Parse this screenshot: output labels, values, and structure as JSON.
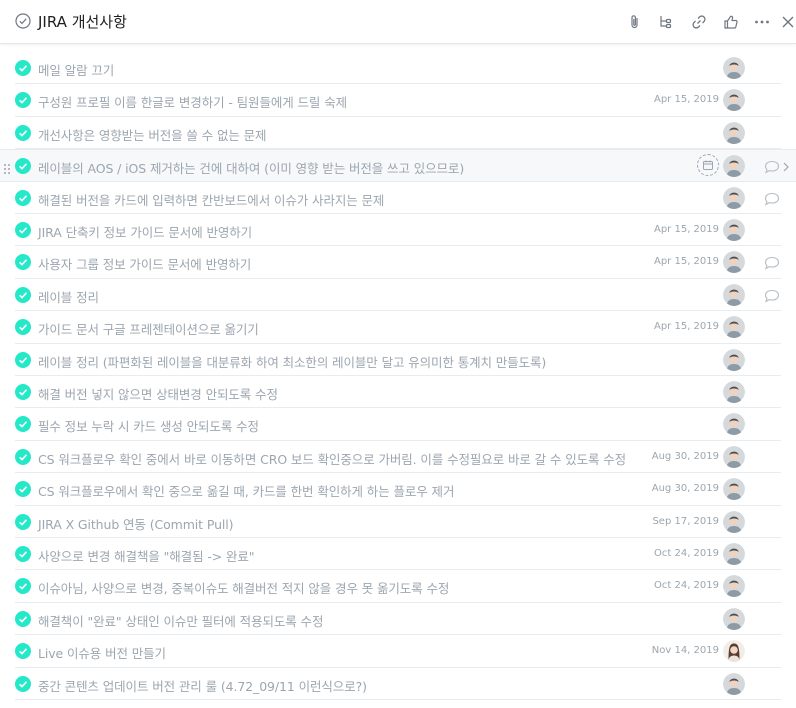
{
  "header": {
    "title": "JIRA 개선사항",
    "icons": [
      "check-circle-icon",
      "attachment-icon",
      "subtask-icon",
      "link-icon",
      "like-icon",
      "more-icon",
      "close-icon"
    ]
  },
  "colors": {
    "check": "#25e8c8",
    "muted_text": "#9ca6af",
    "border": "#e8ecee"
  },
  "tasks": [
    {
      "name": "메일 알람 끄기",
      "date": "",
      "comment": false
    },
    {
      "name": "구성원 프로필 이름 한글로 변경하기 - 팀원들에게 드릴 숙제",
      "date": "Apr 15, 2019",
      "comment": false
    },
    {
      "name": "개선사항은 영향받는 버전을 쓸 수 없는 문제",
      "date": "",
      "comment": false
    },
    {
      "name": "레이블의 AOS / iOS 제거하는 건에 대하여 (이미 영향 받는 버전을 쓰고 있으므로)",
      "date": "",
      "comment": true,
      "highlighted": true
    },
    {
      "name": "해결된 버전을 카드에 입력하면 칸반보드에서 이슈가 사라지는 문제",
      "date": "",
      "comment": true
    },
    {
      "name": "JIRA 단축키 정보 가이드 문서에 반영하기",
      "date": "Apr 15, 2019",
      "comment": false
    },
    {
      "name": "사용자 그룹 정보 가이드 문서에 반영하기",
      "date": "Apr 15, 2019",
      "comment": true
    },
    {
      "name": "레이블 정리",
      "date": "",
      "comment": true
    },
    {
      "name": "가이드 문서 구글 프레젠테이션으로 옮기기",
      "date": "Apr 15, 2019",
      "comment": false
    },
    {
      "name": "레이블 정리 (파편화된 레이블을 대분류화 하여 최소한의 레이블만 달고 유의미한 통계치 만들도록)",
      "date": "",
      "comment": false
    },
    {
      "name": "해결 버전 넣지 않으면 상태변경 안되도록 수정",
      "date": "",
      "comment": false
    },
    {
      "name": "필수 정보 누락 시 카드 생성 안되도록 수정",
      "date": "",
      "comment": false
    },
    {
      "name": "CS 워크플로우 확인 중에서 바로 이동하면 CRO 보드 확인중으로 가버림. 이를 수정필요로 바로 갈 수 있도록 수정",
      "date": "Aug 30, 2019",
      "comment": false
    },
    {
      "name": "CS 워크플로우에서 확인 중으로 옮길 때, 카드를 한번 확인하게 하는 플로우 제거",
      "date": "Aug 30, 2019",
      "comment": false
    },
    {
      "name": "JIRA X Github 연동 (Commit Pull)",
      "date": "Sep 17, 2019",
      "comment": false
    },
    {
      "name": "사양으로 변경 해결책을 \"해결됨 -> 완료\"",
      "date": "Oct 24, 2019",
      "comment": false
    },
    {
      "name": "이슈아님, 사양으로 변경, 중복이슈도 해결버전 적지 않을 경우 못 옮기도록 수정",
      "date": "Oct 24, 2019",
      "comment": false
    },
    {
      "name": "해결책이 \"완료\" 상태인 이슈만 필터에 적용되도록 수정",
      "date": "",
      "comment": false
    },
    {
      "name": "Live 이슈용 버전 만들기",
      "date": "Nov 14, 2019",
      "comment": false,
      "avatar": "female"
    },
    {
      "name": "중간 콘텐츠 업데이트 버전 관리 룰 (4.72_09/11 이런식으로?)",
      "date": "",
      "comment": false
    }
  ]
}
